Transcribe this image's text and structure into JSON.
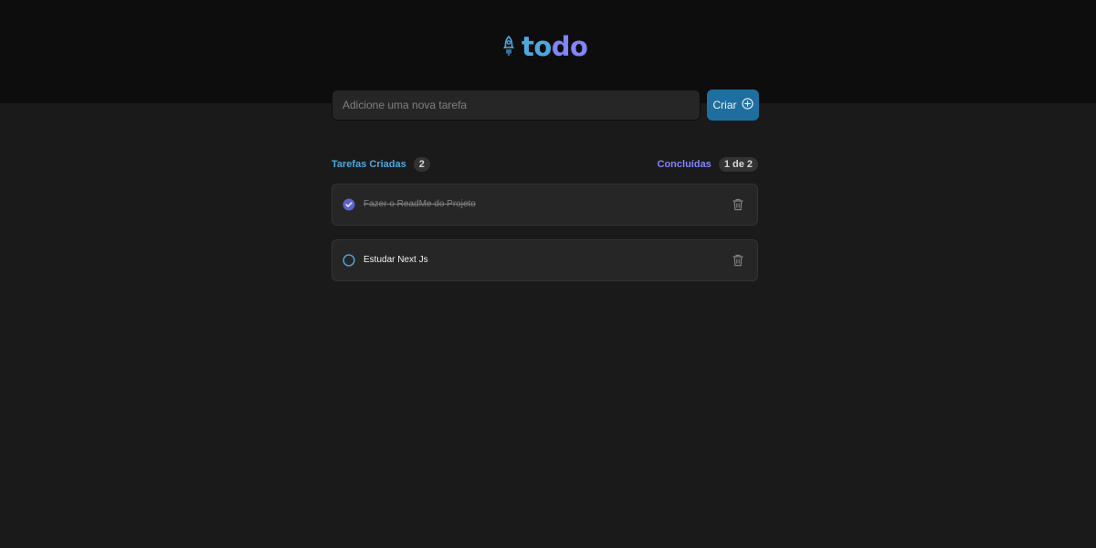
{
  "header": {
    "logo_part1": "to",
    "logo_part2": "do",
    "logo_icon": "rocket-icon"
  },
  "new_task": {
    "placeholder": "Adicione uma nova tarefa",
    "value": "",
    "create_label": "Criar",
    "create_icon": "plus-circle-icon"
  },
  "info": {
    "created_label": "Tarefas Criadas",
    "created_count": "2",
    "done_label": "Concluídas",
    "done_count": "1 de 2"
  },
  "tasks": [
    {
      "text": "Fazer o ReadMe do Projeto",
      "completed": true,
      "delete_icon": "trash-icon"
    },
    {
      "text": "Estudar Next Js",
      "completed": false,
      "delete_icon": "trash-icon"
    }
  ],
  "colors": {
    "blue": "#4ea8de",
    "purple": "#8284fa",
    "button": "#1e6f9f",
    "background": "#1a1a1a",
    "header_bg": "#0d0d0d",
    "card": "#262626"
  }
}
